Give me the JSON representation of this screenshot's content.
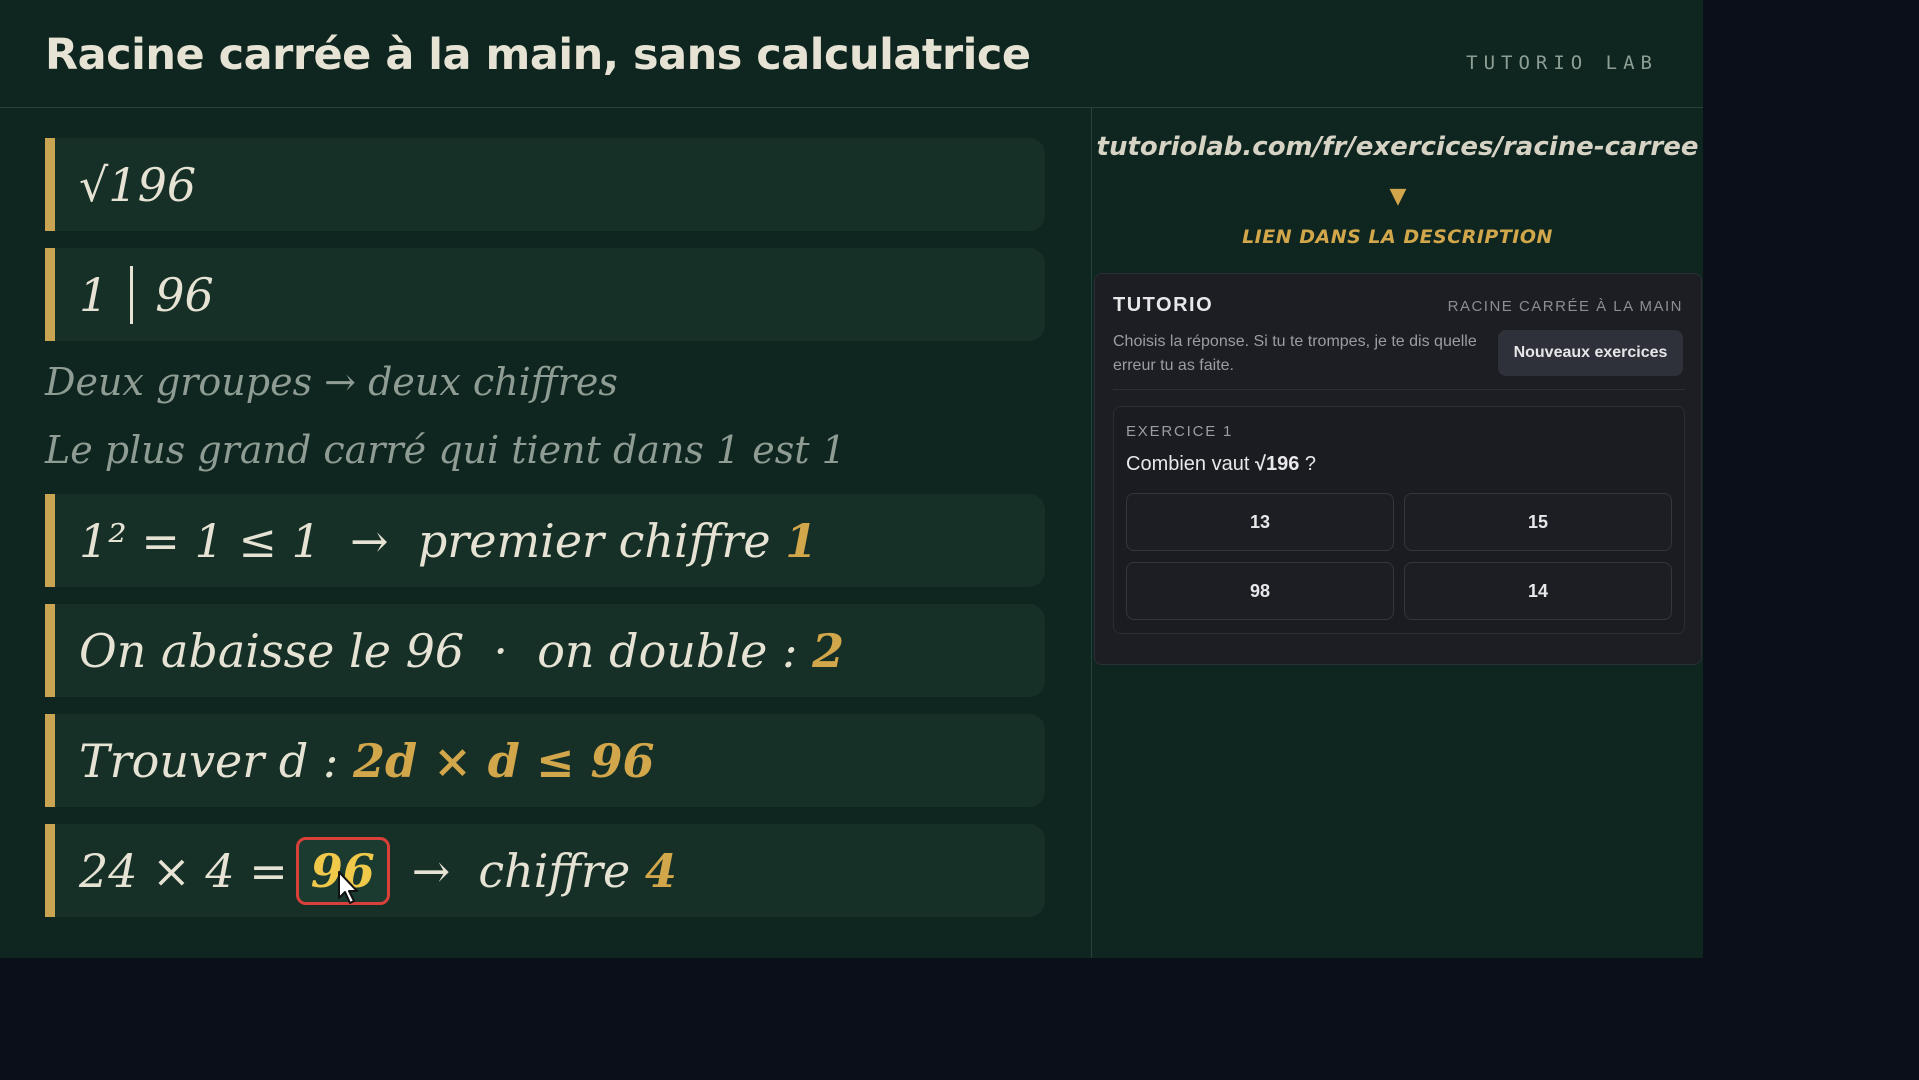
{
  "header": {
    "title": "Racine carrée à la main, sans calculatrice",
    "brand": "TUTORIO LAB"
  },
  "steps": {
    "s1": "√196",
    "s2_left": "1",
    "s2_right": "96",
    "note1": "Deux groupes  →  deux chiffres",
    "note2": "Le plus grand carré qui tient dans 1 est 1",
    "s3_text": "1² = 1 ≤ 1  →  premier chiffre ",
    "s3_value": "1",
    "s4_text": "On abaisse le 96  ·  on double : ",
    "s4_value": "2",
    "s5_text": "Trouver d : ",
    "s5_value": "2d × d ≤ 96",
    "s6_left": "24 × 4 =",
    "s6_highlight": "96",
    "s6_arrow": "→",
    "s6_text": "chiffre ",
    "s6_value": "4"
  },
  "sidebar": {
    "link": "tutoriolab.com/fr/exercices/racine-carree",
    "arrow": "▼",
    "link_note": "LIEN DANS LA DESCRIPTION"
  },
  "widget": {
    "title": "TUTORIO",
    "subtitle": "RACINE CARRÉE À LA MAIN",
    "description": "Choisis la réponse. Si tu te trompes, je te dis quelle erreur tu as faite.",
    "new_button": "Nouveaux exercices",
    "exercise_label": "EXERCICE 1",
    "question_prefix": "Combien vaut ",
    "question_bold": "√196",
    "question_suffix": " ?",
    "options": [
      "13",
      "15",
      "98",
      "14"
    ]
  },
  "colors": {
    "board": "#0f2620",
    "step_bg": "#163027",
    "accent_gold": "#d2a64a",
    "highlight_border": "#d9403a",
    "page_bg": "#0b0f19"
  }
}
